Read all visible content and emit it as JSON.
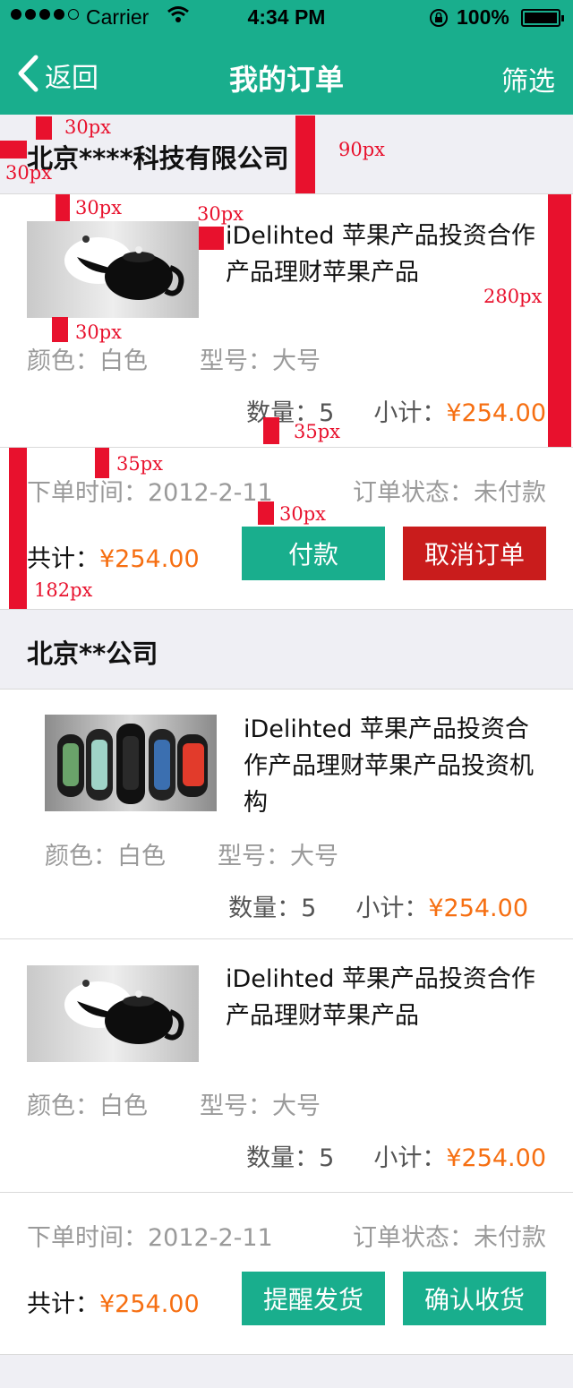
{
  "status_bar": {
    "carrier": "Carrier",
    "time": "4:34 PM",
    "battery": "100%",
    "icons": [
      "signal-dots-icon",
      "wifi-icon",
      "rotation-lock-icon",
      "battery-icon"
    ]
  },
  "nav": {
    "back_label": "返回",
    "title": "我的订单",
    "filter_label": "筛选"
  },
  "orders": [
    {
      "company": "北京****科技有限公司",
      "items": [
        {
          "name": "iDelihted 苹果产品投资合作产品理财苹果产品",
          "image": "teapot",
          "color": "颜色：白色",
          "model": "型号：大号",
          "qty": "数量：5",
          "subtotal_label": "小计：",
          "subtotal": "¥254.00"
        }
      ],
      "order_time": "下单时间：2012-2-11",
      "order_status": "订单状态：未付款",
      "total_label": "共计：",
      "total": "¥254.00",
      "buttons": [
        "付款",
        "取消订单"
      ]
    },
    {
      "company": "北京**公司",
      "items": [
        {
          "name": "iDelihted 苹果产品投资合作产品理财苹果产品投资机构",
          "image": "smartwatch-bands",
          "color": "颜色：白色",
          "model": "型号：大号",
          "qty": "数量：5",
          "subtotal_label": "小计：",
          "subtotal": "¥254.00"
        },
        {
          "name": "iDelihted 苹果产品投资合作产品理财苹果产品",
          "image": "teapot",
          "color": "颜色：白色",
          "model": "型号：大号",
          "qty": "数量：5",
          "subtotal_label": "小计：",
          "subtotal": "¥254.00"
        }
      ],
      "order_time": "下单时间：2012-2-11",
      "order_status": "订单状态：未付款",
      "total_label": "共计：",
      "total": "¥254.00",
      "buttons": [
        "提醒发货",
        "确认收货"
      ]
    }
  ],
  "annotations": [
    "30px",
    "30px",
    "90px",
    "30px",
    "30px",
    "280px",
    "30px",
    "35px",
    "35px",
    "30px",
    "182px"
  ],
  "colors": {
    "brand_green": "#19ae8d",
    "price_orange": "#f66f12",
    "danger_red": "#c91c1c",
    "annotation_red": "#e8112d",
    "page_bg": "#efeff4"
  }
}
